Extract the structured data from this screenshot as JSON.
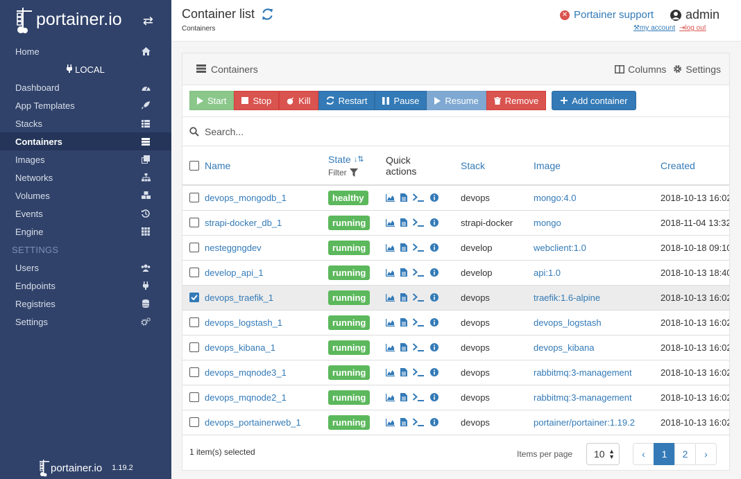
{
  "sidebar": {
    "brand": "portainer.io",
    "endpoint": "LOCAL",
    "home": "Home",
    "items": [
      {
        "label": "Dashboard",
        "icon": "tachometer-icon"
      },
      {
        "label": "App Templates",
        "icon": "rocket-icon"
      },
      {
        "label": "Stacks",
        "icon": "th-list-icon"
      },
      {
        "label": "Containers",
        "icon": "server-icon"
      },
      {
        "label": "Images",
        "icon": "clone-icon"
      },
      {
        "label": "Networks",
        "icon": "sitemap-icon"
      },
      {
        "label": "Volumes",
        "icon": "cubes-icon"
      },
      {
        "label": "Events",
        "icon": "history-icon"
      },
      {
        "label": "Engine",
        "icon": "th-icon"
      }
    ],
    "settings_header": "SETTINGS",
    "settings_items": [
      {
        "label": "Users",
        "icon": "users-icon"
      },
      {
        "label": "Endpoints",
        "icon": "plug-icon"
      },
      {
        "label": "Registries",
        "icon": "database-icon"
      },
      {
        "label": "Settings",
        "icon": "cogs-icon"
      }
    ],
    "footer_brand": "portainer.io",
    "version": "1.19.2"
  },
  "header": {
    "title": "Container list",
    "subtitle": "Containers",
    "support": "Portainer support",
    "user": "admin",
    "my_account": "my account",
    "logout": "log out"
  },
  "panel": {
    "title": "Containers",
    "columns_label": "Columns",
    "settings_label": "Settings"
  },
  "actions": {
    "start": "Start",
    "stop": "Stop",
    "kill": "Kill",
    "restart": "Restart",
    "pause": "Pause",
    "resume": "Resume",
    "remove": "Remove",
    "add": "Add container"
  },
  "search": {
    "placeholder": "Search..."
  },
  "table": {
    "headers": {
      "name": "Name",
      "state": "State",
      "filter": "Filter",
      "quick_actions_1": "Quick",
      "quick_actions_2": "actions",
      "stack": "Stack",
      "image": "Image",
      "created": "Created"
    },
    "rows": [
      {
        "name": "devops_mongodb_1",
        "state": "healthy",
        "stack": "devops",
        "image": "mongo:4.0",
        "created": "2018-10-13 16:02",
        "selected": false
      },
      {
        "name": "strapi-docker_db_1",
        "state": "running",
        "stack": "strapi-docker",
        "image": "mongo",
        "created": "2018-11-04 13:32",
        "selected": false
      },
      {
        "name": "nesteggngdev",
        "state": "running",
        "stack": "develop",
        "image": "webclient:1.0",
        "created": "2018-10-18 09:10",
        "selected": false
      },
      {
        "name": "develop_api_1",
        "state": "running",
        "stack": "develop",
        "image": "api:1.0",
        "created": "2018-10-13 18:40",
        "selected": false
      },
      {
        "name": "devops_traefik_1",
        "state": "running",
        "stack": "devops",
        "image": "traefik:1.6-alpine",
        "created": "2018-10-13 16:02",
        "selected": true
      },
      {
        "name": "devops_logstash_1",
        "state": "running",
        "stack": "devops",
        "image": "devops_logstash",
        "created": "2018-10-13 16:02",
        "selected": false
      },
      {
        "name": "devops_kibana_1",
        "state": "running",
        "stack": "devops",
        "image": "devops_kibana",
        "created": "2018-10-13 16:02",
        "selected": false
      },
      {
        "name": "devops_mqnode3_1",
        "state": "running",
        "stack": "devops",
        "image": "rabbitmq:3-management",
        "created": "2018-10-13 16:02",
        "selected": false
      },
      {
        "name": "devops_mqnode2_1",
        "state": "running",
        "stack": "devops",
        "image": "rabbitmq:3-management",
        "created": "2018-10-13 16:02",
        "selected": false
      },
      {
        "name": "devops_portainerweb_1",
        "state": "running",
        "stack": "devops",
        "image": "portainer/portainer:1.19.2",
        "created": "2018-10-13 16:02",
        "selected": false
      }
    ]
  },
  "footer": {
    "selected": "1 item(s) selected",
    "items_per_page_label": "Items per page",
    "items_per_page": "10",
    "pages": [
      "1",
      "2"
    ],
    "prev": "‹",
    "next": "›"
  },
  "colors": {
    "sidebar": "#30426a",
    "accent": "#337ab7",
    "success": "#5cb85c",
    "danger": "#d9534f"
  }
}
